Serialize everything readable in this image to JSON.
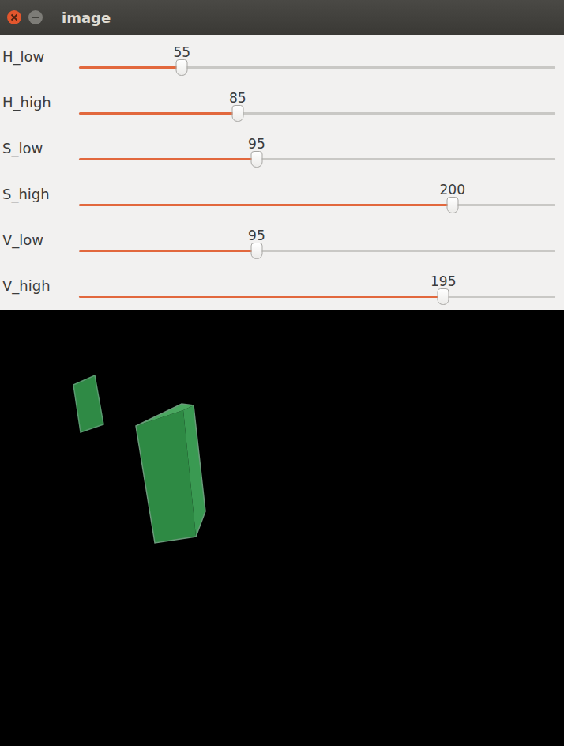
{
  "window": {
    "title": "image"
  },
  "trackbars": [
    {
      "label": "H_low",
      "value": "55",
      "level": 0.216
    },
    {
      "label": "H_high",
      "value": "85",
      "level": 0.333
    },
    {
      "label": "S_low",
      "value": "95",
      "level": 0.373
    },
    {
      "label": "S_high",
      "value": "200",
      "level": 0.784
    },
    {
      "label": "V_low",
      "value": "95",
      "level": 0.373
    },
    {
      "label": "V_high",
      "value": "195",
      "level": 0.765
    }
  ]
}
